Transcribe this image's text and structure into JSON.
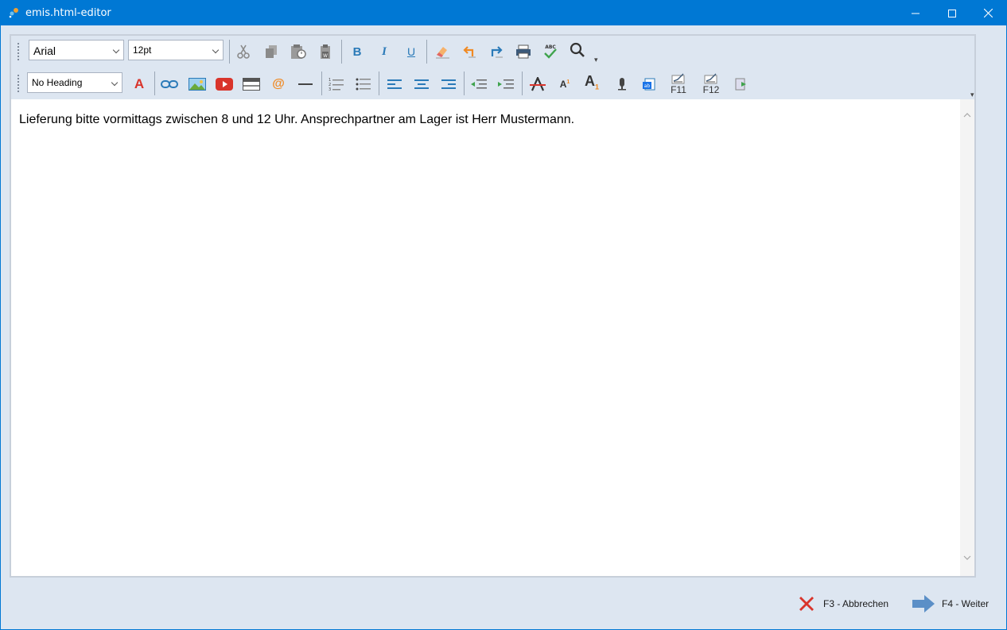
{
  "window": {
    "title": "emis.html-editor"
  },
  "toolbar1": {
    "font_name": "Arial",
    "font_size": "12pt",
    "icons": [
      "cut-icon",
      "copy-icon",
      "paste-icon",
      "paste-from-word-icon",
      "bold-icon",
      "italic-icon",
      "underline-icon",
      "clear-format-icon",
      "undo-icon",
      "redo-icon",
      "print-icon",
      "spellcheck-icon",
      "find-icon"
    ],
    "bold_label": "B",
    "italic_label": "I",
    "underline_label": "U",
    "spellcheck_label": "ABC"
  },
  "toolbar2": {
    "heading": "No Heading",
    "font_color_label": "A",
    "email_label": "@",
    "superscript_label": "A",
    "subscript_label": "A",
    "subscript_index": "1",
    "f11_label": "F11",
    "f12_label": "F12"
  },
  "document": {
    "text": "Lieferung bitte vormittags zwischen 8 und 12 Uhr. Ansprechpartner am Lager ist Herr Mustermann."
  },
  "footer": {
    "cancel_label": "F3 - Abbrechen",
    "next_label": "F4 - Weiter"
  },
  "colors": {
    "titlebar": "#0078d4",
    "chrome": "#dde6f1",
    "accent_blue": "#2a7ab8",
    "red": "#d9342b",
    "orange": "#f08a24"
  }
}
